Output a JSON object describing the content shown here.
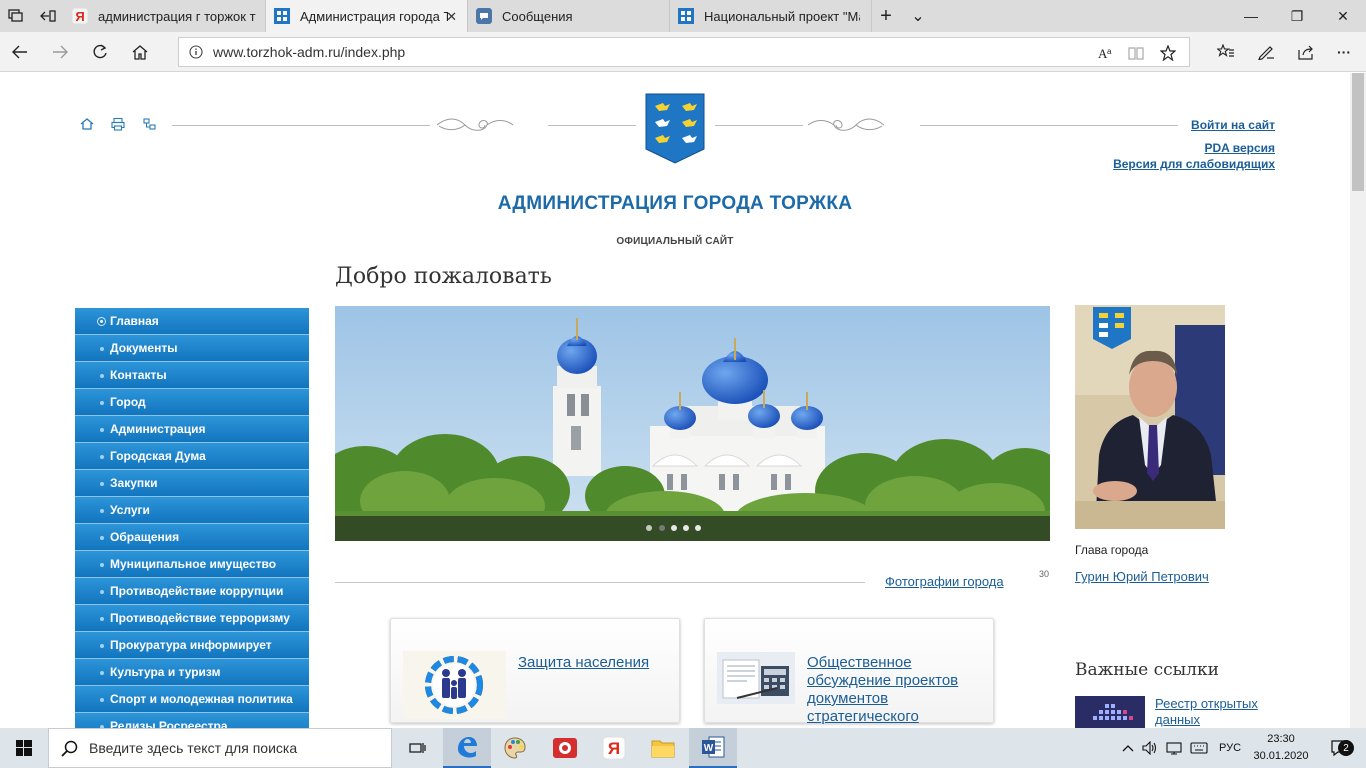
{
  "browser": {
    "tabs": [
      {
        "title": "администрация г торжок т",
        "favicon": "yandex-icon",
        "active": false
      },
      {
        "title": "Администрация города Торжка",
        "favicon": "site-icon",
        "active": true
      },
      {
        "title": "Сообщения",
        "favicon": "messages-icon",
        "active": false
      },
      {
        "title": "Национальный проект \"Малое",
        "favicon": "site-icon",
        "active": false
      }
    ],
    "url": "www.torzhok-adm.ru/index.php",
    "close_glyph": "✕",
    "new_tab_glyph": "+",
    "tabs_menu_glyph": "⌄",
    "window_controls": {
      "minimize": "—",
      "restore": "❐",
      "close": "✕"
    },
    "more_glyph": "···"
  },
  "site": {
    "title": "АДМИНИСТРАЦИЯ ГОРОДА ТОРЖКА",
    "subtitle": "ОФИЦИАЛЬНЫЙ САЙТ",
    "top_links": {
      "login": "Войти на сайт",
      "pda": "PDA версия",
      "low_vision": "Версия для слабовидящих"
    },
    "welcome": "Добро пожаловать",
    "menu": [
      "Главная",
      "Документы",
      "Контакты",
      "Город",
      "Администрация",
      "Городская Дума",
      "Закупки",
      "Услуги",
      "Обращения",
      "Муниципальное имущество",
      "Противодействие коррупции",
      "Противодействие терроризму",
      "Прокуратура информирует",
      "Культура и туризм",
      "Спорт и молодежная политика",
      "Релизы Росреестра"
    ],
    "menu_active_index": 0,
    "slider": {
      "dots": 5,
      "active_dot": 1
    },
    "photos_link": "Фотографии города",
    "photos_count": "30",
    "cards": [
      {
        "label": "Защита населения"
      },
      {
        "label": "Общественное обсуждение проектов документов стратегического планирования"
      }
    ],
    "mayor": {
      "caption": "Глава города",
      "name": "Гурин Юрий Петрович"
    },
    "links_heading": "Важные ссылки",
    "links": [
      {
        "label": "Реестр открытых данных"
      }
    ]
  },
  "taskbar": {
    "search_placeholder": "Введите здесь текст для поиска",
    "language": "РУС",
    "time": "23:30",
    "date": "30.01.2020",
    "notifications": "2"
  },
  "colors": {
    "menu": "#1a7fc7",
    "title": "#1d6aa8",
    "link": "#1b5e96",
    "emblem": "#1f76c5"
  }
}
